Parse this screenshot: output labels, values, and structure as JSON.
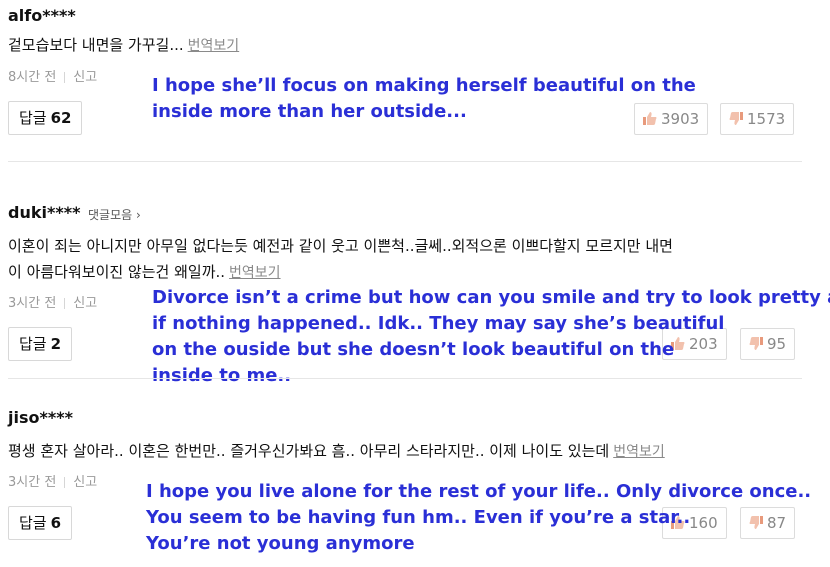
{
  "comments": [
    {
      "username": "alfo****",
      "text_lines": [
        "겉모습보다 내면을 가꾸길..."
      ],
      "translate_label": "번역보기",
      "time": "8시간 전",
      "report": "신고",
      "reply_label": "답글",
      "reply_count": "62",
      "likes": "3903",
      "dislikes": "1573",
      "overlay_lines": [
        "I hope she’ll focus on making herself beautiful on the",
        "inside more than her outside..."
      ]
    },
    {
      "username": "duki****",
      "more_link": "댓글모음 ›",
      "text_lines": [
        "이혼이 죄는 아니지만 아무일 없다는듯 예전과 같이 웃고 이쁜척..글쎄..외적으론 이쁘다할지 모르지만 내면",
        "이 아름다워보이진 않는건 왜일까.."
      ],
      "translate_label": "번역보기",
      "time": "3시간 전",
      "report": "신고",
      "reply_label": "답글",
      "reply_count": "2",
      "likes": "203",
      "dislikes": "95",
      "overlay_lines": [
        "Divorce isn’t a crime but how can you smile and try to look pretty as",
        "if nothing happened.. Idk.. They may say she’s beautiful",
        "on the ouside but she doesn’t look beautiful on the",
        "inside to me.."
      ]
    },
    {
      "username": "jiso****",
      "text_lines": [
        "평생 혼자 살아라.. 이혼은 한번만.. 즐거우신가봐요 흠.. 아무리 스타라지만.. 이제 나이도 있는데"
      ],
      "translate_label": "번역보기",
      "time": "3시간 전",
      "report": "신고",
      "reply_label": "답글",
      "reply_count": "6",
      "likes": "160",
      "dislikes": "87",
      "overlay_lines": [
        "I hope you live alone for the rest of your life.. Only divorce once..",
        "You seem to be having fun hm.. Even if you’re a star..",
        "You’re not young anymore"
      ]
    }
  ],
  "colors": {
    "overlay": "#2a2fd6",
    "thumb": "#e89a7c"
  },
  "icons": {
    "like": "thumbs-up-icon",
    "dislike": "thumbs-down-icon"
  }
}
